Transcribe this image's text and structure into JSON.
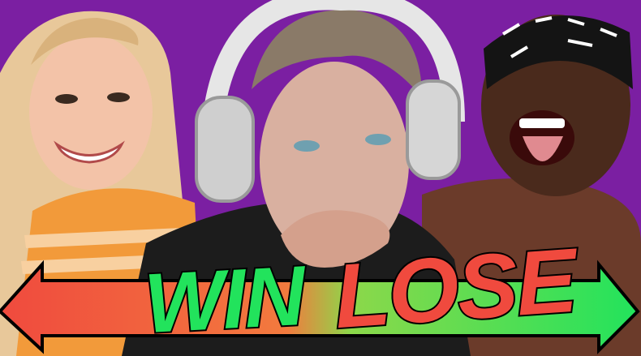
{
  "thumbnail": {
    "background_color": "#7b1fa2",
    "caption_left": "WIN",
    "caption_right": "LOSE",
    "caption_left_color": "#22e35c",
    "caption_right_color": "#f04a3e",
    "arrow_left_color": "#f04a3e",
    "arrow_right_color": "#22e35c"
  }
}
